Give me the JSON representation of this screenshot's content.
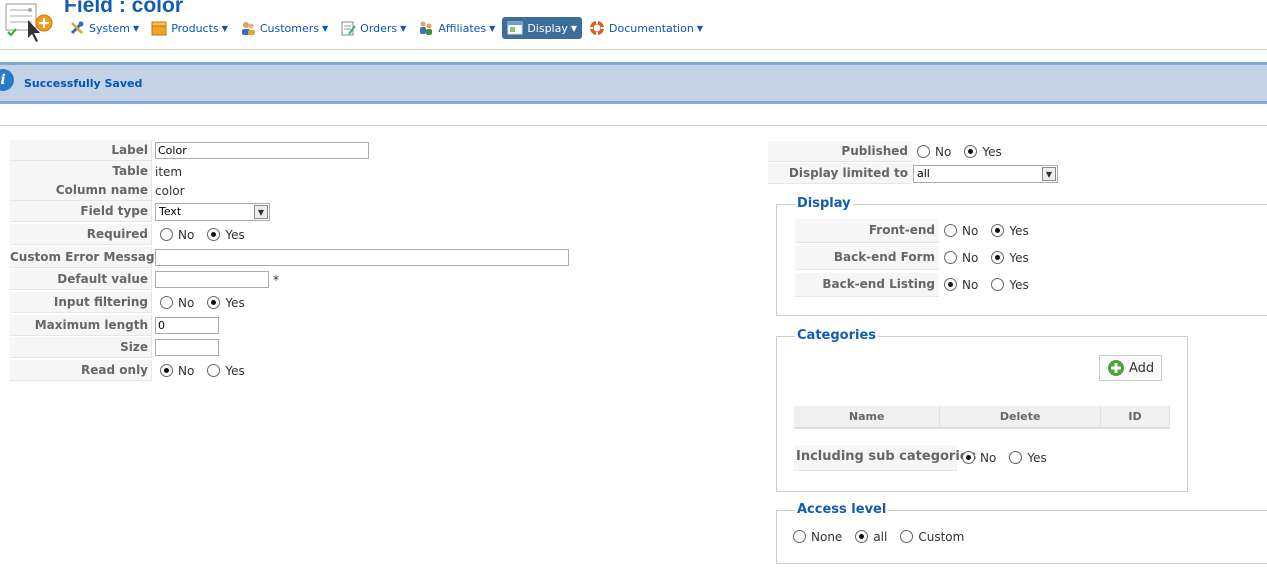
{
  "header": {
    "title": "Field : color",
    "menu": [
      {
        "label": "System",
        "icon": "tools-icon"
      },
      {
        "label": "Products",
        "icon": "products-icon"
      },
      {
        "label": "Customers",
        "icon": "customers-icon"
      },
      {
        "label": "Orders",
        "icon": "orders-icon"
      },
      {
        "label": "Affiliates",
        "icon": "affiliates-icon"
      },
      {
        "label": "Display",
        "icon": "display-icon",
        "active": true
      },
      {
        "label": "Documentation",
        "icon": "help-icon"
      }
    ]
  },
  "message": {
    "text": "Successfully Saved",
    "icon": "info-icon"
  },
  "form": {
    "label": {
      "label": "Label",
      "value": "Color"
    },
    "table": {
      "label": "Table",
      "value": "item"
    },
    "column_name": {
      "label": "Column name",
      "value": "color"
    },
    "field_type": {
      "label": "Field type",
      "value": "Text"
    },
    "required": {
      "label": "Required",
      "no": "No",
      "yes": "Yes",
      "selected": "Yes"
    },
    "custom_error": {
      "label": "Custom Error Message",
      "value": ""
    },
    "default_value": {
      "label": "Default value",
      "value": "",
      "required_mark": "*"
    },
    "input_filtering": {
      "label": "Input filtering",
      "no": "No",
      "yes": "Yes",
      "selected": "Yes"
    },
    "max_length": {
      "label": "Maximum length",
      "value": "0"
    },
    "size": {
      "label": "Size",
      "value": ""
    },
    "read_only": {
      "label": "Read only",
      "no": "No",
      "yes": "Yes",
      "selected": "No"
    }
  },
  "right": {
    "published": {
      "label": "Published",
      "no": "No",
      "yes": "Yes",
      "selected": "Yes"
    },
    "display_limited": {
      "label": "Display limited to",
      "value": "all"
    },
    "display": {
      "legend": "Display",
      "frontend": {
        "label": "Front-end",
        "no": "No",
        "yes": "Yes",
        "selected": "Yes"
      },
      "backend_form": {
        "label": "Back-end Form",
        "no": "No",
        "yes": "Yes",
        "selected": "Yes"
      },
      "backend_listing": {
        "label": "Back-end Listing",
        "no": "No",
        "yes": "Yes",
        "selected": "No"
      }
    },
    "categories": {
      "legend": "Categories",
      "add_label": "Add",
      "columns": [
        "Name",
        "Delete",
        "ID"
      ],
      "include_sub": {
        "label": "Including sub categories",
        "no": "No",
        "yes": "Yes",
        "selected": "No"
      }
    },
    "access": {
      "legend": "Access level",
      "none": "None",
      "all": "all",
      "custom": "Custom",
      "selected": "all"
    }
  }
}
